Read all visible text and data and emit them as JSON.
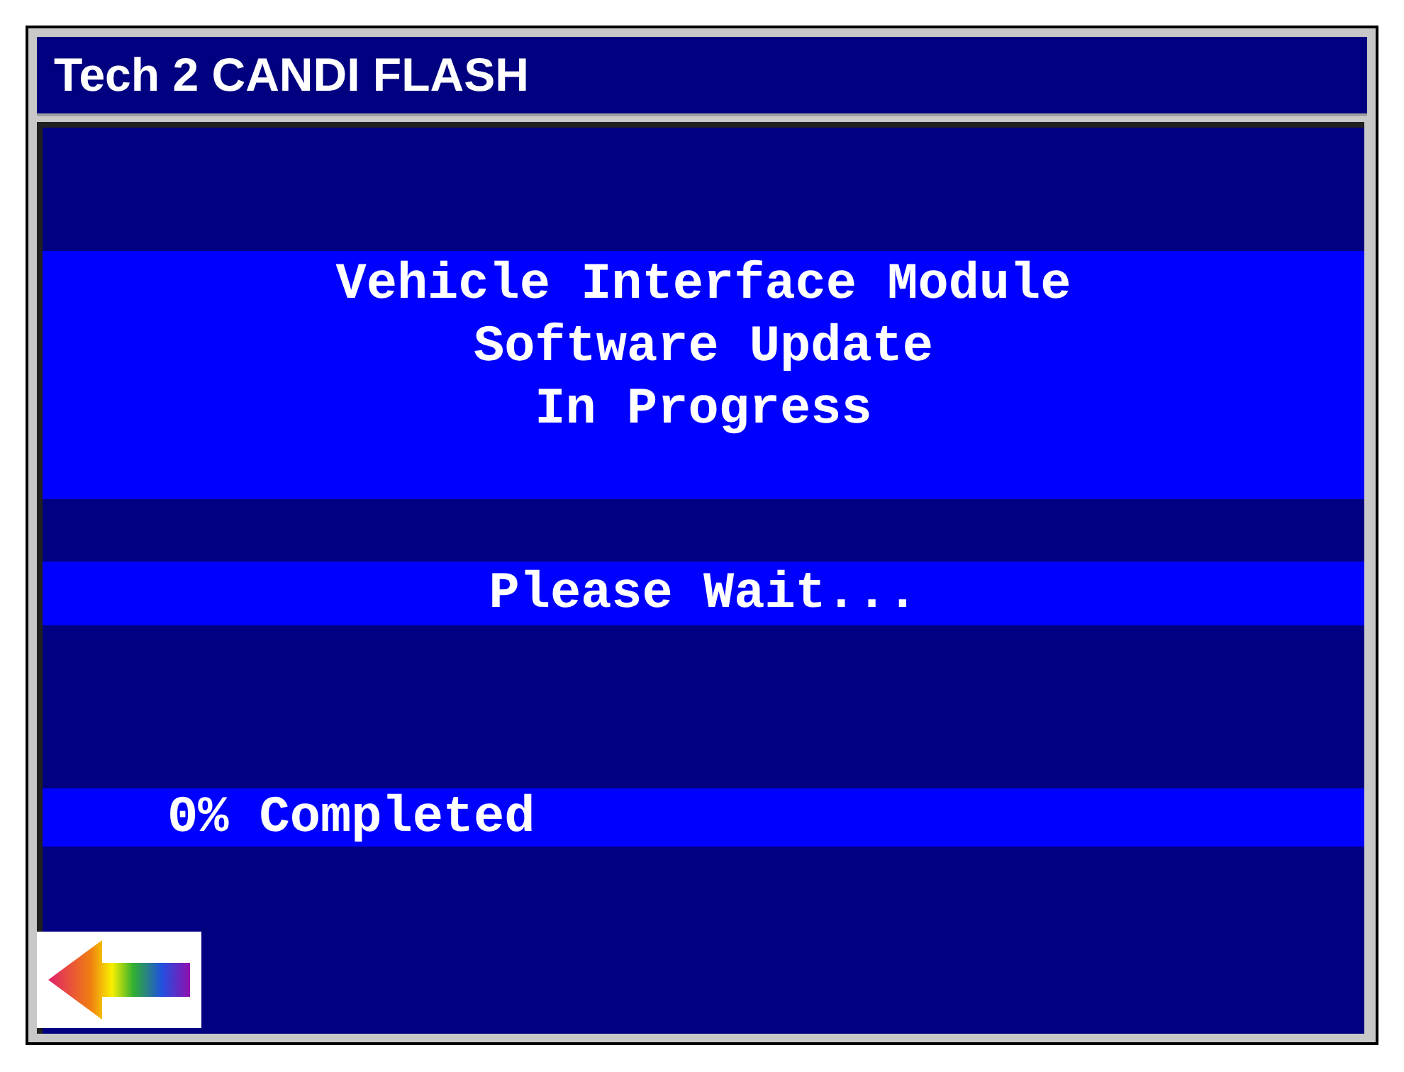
{
  "window": {
    "title": "Tech 2 CANDI FLASH"
  },
  "message": {
    "lines": [
      "Vehicle Interface Module",
      "Software Update",
      "In Progress"
    ]
  },
  "status": "Please Wait...",
  "progress": "0% Completed",
  "back_button": {
    "kind": "arrow"
  }
}
